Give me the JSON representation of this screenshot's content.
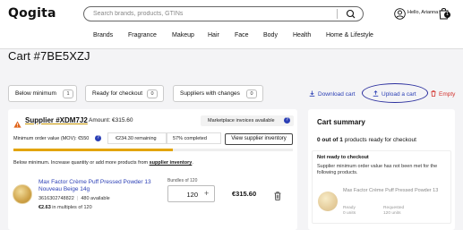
{
  "header": {
    "logo": "Qogita",
    "search_placeholder": "Search brands, products, GTINs",
    "user_label": "Hello, Arianna",
    "cart_count": "1"
  },
  "nav": [
    "Brands",
    "Fragrance",
    "Makeup",
    "Hair",
    "Face",
    "Body",
    "Health",
    "Home & Lifestyle"
  ],
  "page": {
    "title": "Cart #7BE5XZJ"
  },
  "filters": [
    {
      "label": "Below minimum",
      "count": "1"
    },
    {
      "label": "Ready for checkout",
      "count": "0"
    },
    {
      "label": "Suppliers with changes",
      "count": "0"
    }
  ],
  "actions": {
    "download": "Download cart",
    "upload": "Upload a cart",
    "empty": "Empty"
  },
  "supplier": {
    "name": "Supplier #XDM7J2",
    "amount": "Amount: €315.60",
    "marketplace_badge": "Marketplace invoices available",
    "mov": "Minimum order value (MOV): €550",
    "remaining": "€234.30 remaining",
    "completed": "57% completed",
    "completed_fraction": 0.57,
    "view_inventory": "View supplier inventory",
    "below_note": "Below minimum. Increase quantity or add more products from",
    "below_link": "supplier inventory",
    "below_end": "."
  },
  "product": {
    "name": "Max Factor Crème Puff Pressed Powder 13 Nouveau Beige 14g",
    "gtin": "3616302748822",
    "available": "480 available",
    "price": "€2.63",
    "multiples": "in multiples of 120",
    "bundles_label": "Bundles of 120",
    "quantity": "120",
    "line_total": "€315.60"
  },
  "summary": {
    "title": "Cart summary",
    "ready_bold": "0 out of 1",
    "ready_rest": "products ready for checkout",
    "not_ready": "Not ready to checkout",
    "note": "Supplier minimum order value has not been met for the following products.",
    "product_name": "Max Factor Crème Puff Pressed Powder 13",
    "ready_label": "Ready",
    "ready_value": "0 units",
    "requested_label": "Requested",
    "requested_value": "120 units"
  }
}
